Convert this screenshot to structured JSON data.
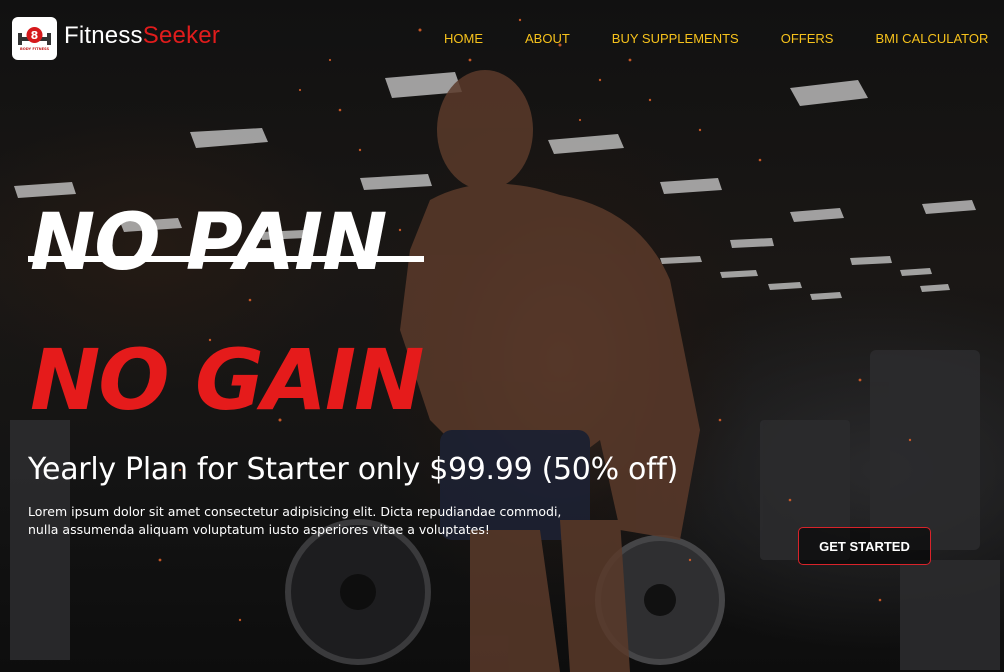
{
  "brand": {
    "name_part1": "Fitness",
    "name_part2": "Seeker",
    "logo_mark_text": "8",
    "logo_caption": "BODY FITNESS"
  },
  "nav": {
    "items": [
      "HOME",
      "ABOUT",
      "BUY SUPPLEMENTS",
      "OFFERS",
      "BMI CALCULATOR"
    ]
  },
  "hero": {
    "line1": "NO PAIN",
    "line2": "NO GAIN",
    "plan_text": "Yearly Plan for Starter only $99.99 (50% off)",
    "description": "Lorem ipsum dolor sit amet consectetur adipisicing elit. Dicta repudiandae commodi, nulla assumenda aliquam voluptatum iusto asperiores vitae a voluptates!",
    "cta_label": "GET STARTED"
  },
  "colors": {
    "nav_text": "#f6c21c",
    "accent_red": "#e51b1b",
    "background": "#0c0c0c"
  }
}
